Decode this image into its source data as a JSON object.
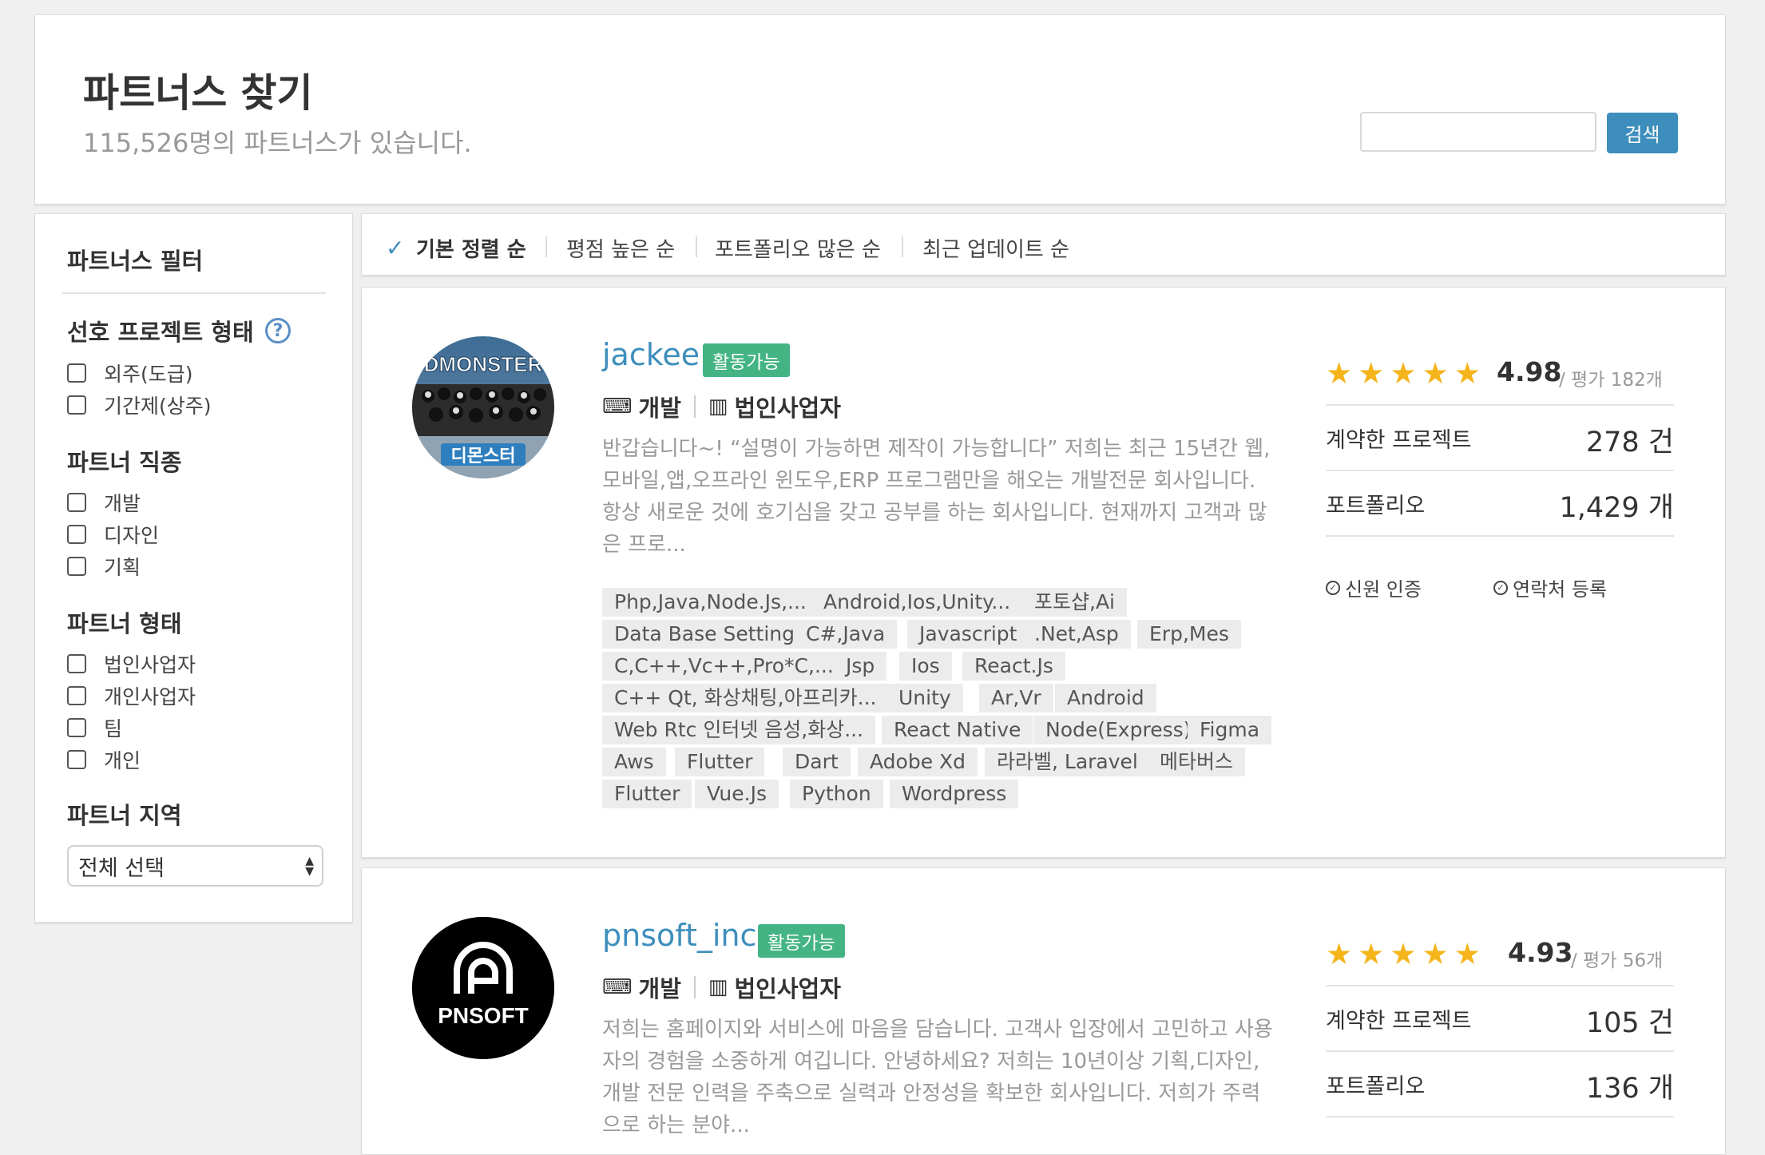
{
  "header": {
    "title": "파트너스 찾기",
    "subtitle": "115,526명의 파트너스가 있습니다.",
    "search_placeholder": "",
    "search_button": "검색"
  },
  "sidebar": {
    "title": "파트너스 필터",
    "project_type": {
      "label": "선호 프로젝트 형태",
      "help": "?",
      "options": [
        "외주(도급)",
        "기간제(상주)"
      ]
    },
    "job": {
      "label": "파트너 직종",
      "options": [
        "개발",
        "디자인",
        "기획"
      ]
    },
    "partner_type": {
      "label": "파트너 형태",
      "options": [
        "법인사업자",
        "개인사업자",
        "팀",
        "개인"
      ]
    },
    "region": {
      "label": "파트너 지역",
      "selected": "전체 선택"
    }
  },
  "sort": {
    "items": [
      "기본 정렬 순",
      "평점 높은 순",
      "포트폴리오 많은 순",
      "최근 업데이트 순"
    ],
    "active": "기본 정렬 순"
  },
  "partners": [
    {
      "name": "jackee",
      "status": "활동가능",
      "field": "개발",
      "type": "법인사업자",
      "avatar_top": "DMONSTER",
      "avatar_bottom": "디몬스터",
      "desc_lines": [
        "반갑습니다~! “설명이 가능하면 제작이 가능합니다” 저희는 최근 15년간 웹,",
        "모바일,앱,오프라인 윈도우,ERP 프로그램만을 해오는 개발전문 회사입니다.",
        "항상 새로운 것에 호기심을 갖고 공부를 하는 회사입니다. 현재까지 고객과 많",
        "은 프로..."
      ],
      "tags": [
        [
          "Php,Java,Node.Js,...",
          "Android,Ios,Unity...",
          "포토샵,Ai"
        ],
        [
          "Data Base Setting",
          "C#,Java",
          "Javascript",
          ".Net,Asp",
          "Erp,Mes"
        ],
        [
          "C,C++,Vc++,Pro*C,...",
          "Jsp",
          "Ios",
          "React.Js"
        ],
        [
          "C++ Qt, 화상채팅,아프리카...",
          "Unity",
          "Ar,Vr",
          "Android"
        ],
        [
          "Web Rtc 인터넷 음성,화상...",
          "React Native",
          "Node(Express)",
          "Figma"
        ],
        [
          "Aws",
          "Flutter",
          "Dart",
          "Adobe Xd",
          "라라벨, Laravel",
          "메타버스"
        ],
        [
          "Flutter",
          "Vue.Js",
          "Python",
          "Wordpress"
        ]
      ],
      "rating": "4.98",
      "rating_value": 4.98,
      "reviews": "/ 평가 182개",
      "contracts_label": "계약한 프로젝트",
      "contracts": "278 건",
      "portfolio_label": "포트폴리오",
      "portfolio": "1,429 개",
      "verify": [
        "신원 인증",
        "연락처 등록"
      ]
    },
    {
      "name": "pnsoft_inc",
      "status": "활동가능",
      "field": "개발",
      "type": "법인사업자",
      "avatar_text": "PNSOFT",
      "desc_lines": [
        "저희는 홈페이지와 서비스에 마음을 담습니다. 고객사 입장에서 고민하고 사용",
        "자의 경험을 소중하게 여깁니다. 안녕하세요? 저희는 10년이상 기획,디자인,",
        "개발 전문 인력을 주축으로 실력과 안정성을 확보한 회사입니다. 저희가 주력",
        "으로 하는 분야..."
      ],
      "rating": "4.93",
      "rating_value": 4.93,
      "reviews": "/ 평가 56개",
      "contracts_label": "계약한 프로젝트",
      "contracts": "105 건",
      "portfolio_label": "포트폴리오",
      "portfolio": "136 개"
    }
  ],
  "icons": {
    "check": "check-icon",
    "help": "question-circle-icon",
    "keyboard": "keyboard-icon",
    "building": "building-icon",
    "star": "star-icon",
    "verified": "check-circle-icon",
    "select_arrows": "updown-arrows-icon"
  },
  "colors": {
    "accent": "#3d8ebc",
    "badge": "#44b484",
    "star": "#f4b41a"
  }
}
